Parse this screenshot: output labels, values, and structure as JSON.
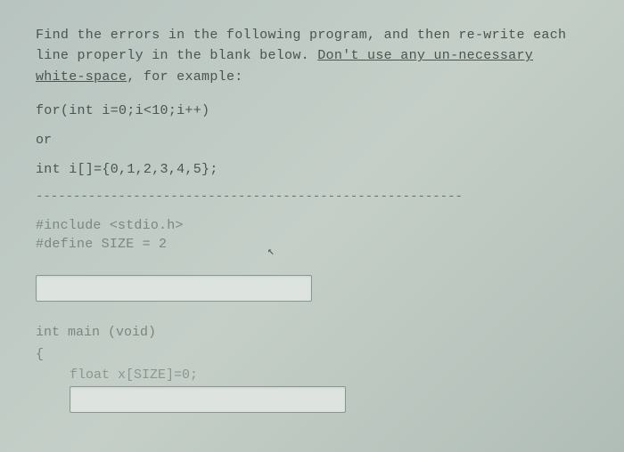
{
  "instruction": {
    "part1": "Find the errors in the following program, and then re-write each line properly in the blank below. ",
    "underlined": "Don't use any un-necessary white-space",
    "part2": ", for example:"
  },
  "examples": {
    "for_loop": "for(int i=0;i<10;i++)",
    "or_word": "or",
    "array_decl": "int i[]={0,1,2,3,4,5};"
  },
  "separator": "---------------------------------------------------------",
  "code": {
    "include": "#include <stdio.h>",
    "define": "#define SIZE = 2",
    "main_sig": "int main (void)",
    "brace": "{",
    "float_line": "float x[SIZE]=0;"
  },
  "inputs": {
    "answer1": "",
    "answer2": ""
  }
}
